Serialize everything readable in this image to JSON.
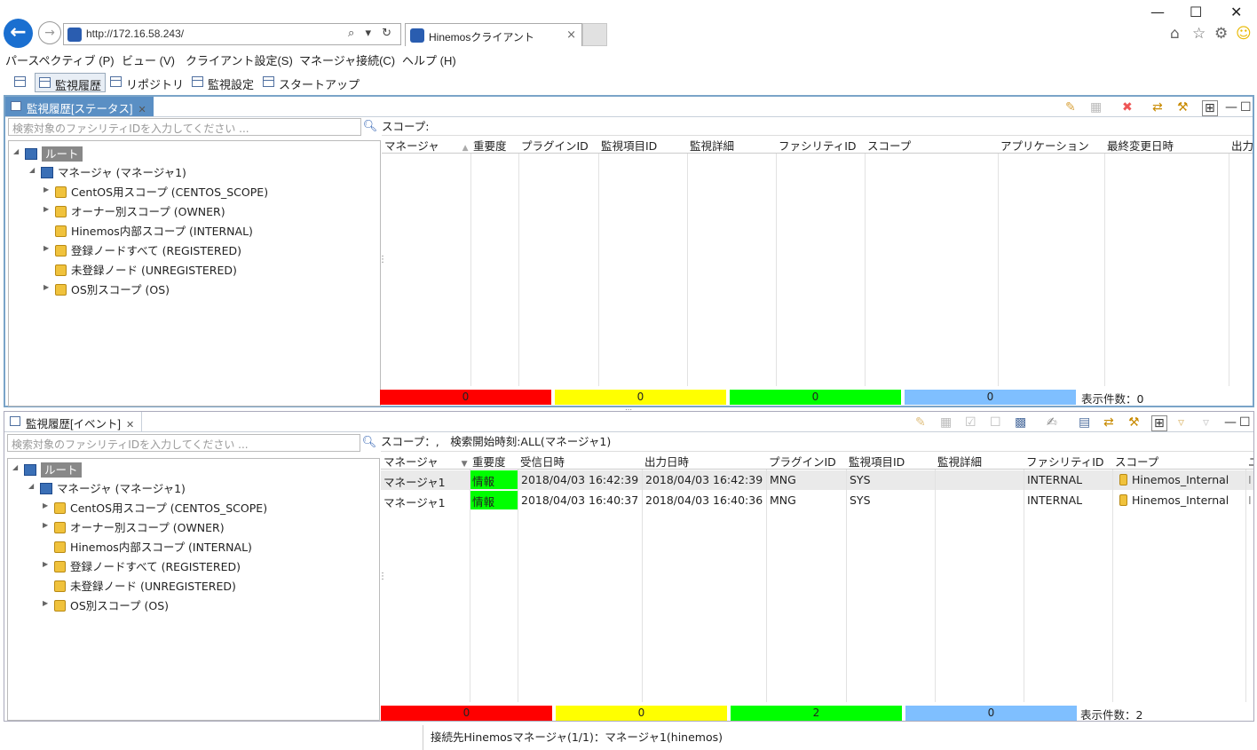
{
  "browser": {
    "back": "←",
    "forward": "→",
    "url": "http://172.16.58.243/",
    "search_controls": "⌕ ▾ ↻",
    "tab_title": "Hinemosクライアント",
    "tab_close": "×",
    "window_controls": {
      "minimize": "—",
      "maximize": "☐",
      "close": "✕"
    },
    "right_icons": {
      "home": "⌂",
      "favorites": "☆",
      "settings": "⚙",
      "smiley": "☺"
    }
  },
  "menu": {
    "items": [
      "パースペクティブ (P)",
      "ビュー (V)",
      "クライアント設定(S)",
      "マネージャ接続(C)",
      "ヘルプ (H)"
    ]
  },
  "toolbar": {
    "perspectives": [
      "監視履歴",
      "リポジトリ",
      "監視設定",
      "スタートアップ"
    ]
  },
  "status_view": {
    "title": "監視履歴[ステータス]",
    "search_placeholder": "検索対象のファシリティIDを入力してください ...",
    "scope_line": "スコープ:",
    "columns": [
      "マネージャ",
      "重要度",
      "プラグインID",
      "監視項目ID",
      "監視詳細",
      "ファシリティID",
      "スコープ",
      "アプリケーション",
      "最終変更日時",
      "出力"
    ],
    "counts": [
      "0",
      "0",
      "0",
      "0"
    ],
    "display_count": "表示件数：0"
  },
  "event_view": {
    "title": "監視履歴[イベント]",
    "search_placeholder": "検索対象のファシリティIDを入力してください ...",
    "scope_line": "スコープ：,　検索開始時刻:ALL(マネージャ1)",
    "columns": [
      "マネージャ",
      "重要度",
      "受信日時",
      "出力日時",
      "プラグインID",
      "監視項目ID",
      "監視詳細",
      "ファシリティID",
      "スコープ",
      "ユ"
    ],
    "rows": [
      {
        "manager": "マネージャ1",
        "severity": "情報",
        "received": "2018/04/03 16:42:39",
        "output": "2018/04/03 16:42:39",
        "plugin": "MNG",
        "monitor": "SYS",
        "detail": "",
        "facility": "INTERNAL",
        "scope": "Hinemos_Internal",
        "extra": "I"
      },
      {
        "manager": "マネージャ1",
        "severity": "情報",
        "received": "2018/04/03 16:40:37",
        "output": "2018/04/03 16:40:36",
        "plugin": "MNG",
        "monitor": "SYS",
        "detail": "",
        "facility": "INTERNAL",
        "scope": "Hinemos_Internal",
        "extra": "I"
      }
    ],
    "counts": [
      "0",
      "0",
      "2",
      "0"
    ],
    "display_count": "表示件数：2"
  },
  "tree": {
    "root": "ルート",
    "manager": "マネージャ (マネージャ1)",
    "scopes": [
      "CentOS用スコープ (CENTOS_SCOPE)",
      "オーナー別スコープ (OWNER)",
      "Hinemos内部スコープ (INTERNAL)",
      "登録ノードすべて (REGISTERED)",
      "未登録ノード (UNREGISTERED)",
      "OS別スコープ (OS)"
    ]
  },
  "status_bar": "接続先Hinemosマネージャ(1/1)：マネージャ1(hinemos)",
  "colors": {
    "critical": "#ff0000",
    "warning": "#ffff00",
    "info": "#00ff00",
    "unknown": "#7fbfff",
    "accent": "#5a8fc4"
  }
}
